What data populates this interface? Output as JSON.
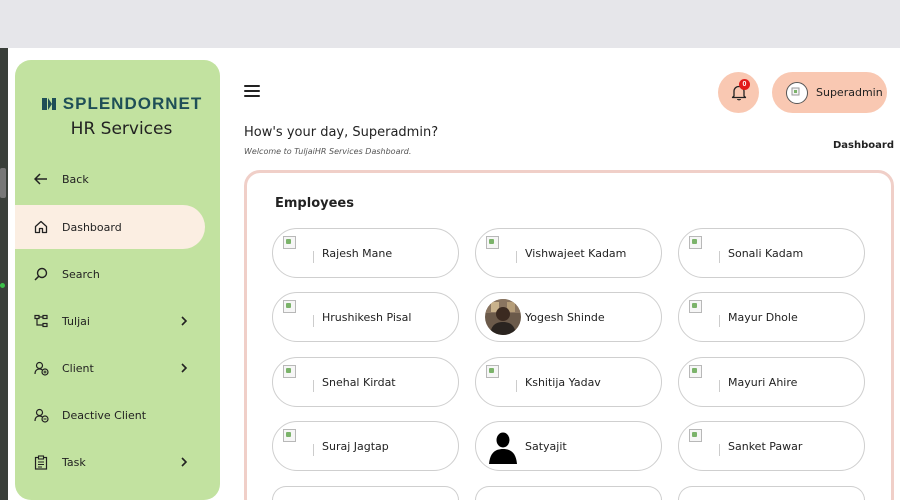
{
  "brand": {
    "name": "SPLENDORNET",
    "subtitle": "HR Services",
    "colors": {
      "sidebar": "#c2e2a0",
      "active_item": "#fbeee2",
      "accent": "#f9c8b2",
      "logo": "#1f4f57"
    }
  },
  "sidebar": {
    "items": [
      {
        "label": "Back",
        "icon": "arrow-left-icon",
        "has_submenu": false
      },
      {
        "label": "Dashboard",
        "icon": "home-icon",
        "has_submenu": false,
        "active": true
      },
      {
        "label": "Search",
        "icon": "search-icon",
        "has_submenu": false
      },
      {
        "label": "Tuljai",
        "icon": "hierarchy-icon",
        "has_submenu": true
      },
      {
        "label": "Client",
        "icon": "user-add-icon",
        "has_submenu": true
      },
      {
        "label": "Deactive Client",
        "icon": "user-remove-icon",
        "has_submenu": false
      },
      {
        "label": "Task",
        "icon": "clipboard-icon",
        "has_submenu": true
      }
    ]
  },
  "header": {
    "menu_icon": "hamburger-icon",
    "notifications": {
      "icon": "bell-icon",
      "count": "0"
    },
    "user": {
      "name": "Superadmin",
      "icon": "avatar-icon"
    },
    "greeting": "How's your day, Superadmin?",
    "welcome": "Welcome to TuljaiHR Services Dashboard.",
    "breadcrumb": "Dashboard"
  },
  "employees": {
    "title": "Employees",
    "list": [
      {
        "name": "Rajesh Mane",
        "photo": "broken"
      },
      {
        "name": "Vishwajeet Kadam",
        "photo": "broken"
      },
      {
        "name": "Sonali Kadam",
        "photo": "broken"
      },
      {
        "name": "Hrushikesh Pisal",
        "photo": "broken"
      },
      {
        "name": "Yogesh Shinde",
        "photo": "portrait"
      },
      {
        "name": "Mayur Dhole",
        "photo": "broken"
      },
      {
        "name": "Snehal Kirdat",
        "photo": "broken"
      },
      {
        "name": "Kshitija Yadav",
        "photo": "broken"
      },
      {
        "name": "Mayuri Ahire",
        "photo": "broken"
      },
      {
        "name": "Suraj Jagtap",
        "photo": "broken"
      },
      {
        "name": "Satyajit",
        "photo": "silhouette"
      },
      {
        "name": "Sanket Pawar",
        "photo": "broken"
      }
    ]
  }
}
